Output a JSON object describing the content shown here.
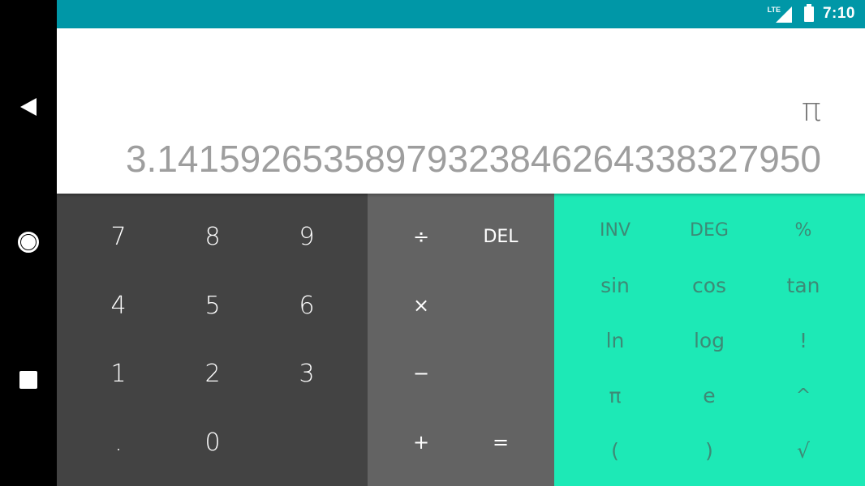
{
  "status_bar": {
    "network": "LTE",
    "time": "7:10"
  },
  "display": {
    "formula": "π",
    "result": "3.14159265358979323846264338327950"
  },
  "numeric_pad": [
    {
      "key": "7"
    },
    {
      "key": "8"
    },
    {
      "key": "9"
    },
    {
      "key": "4"
    },
    {
      "key": "5"
    },
    {
      "key": "6"
    },
    {
      "key": "1"
    },
    {
      "key": "2"
    },
    {
      "key": "3"
    },
    {
      "key": "."
    },
    {
      "key": "0"
    }
  ],
  "operator_pad": {
    "divide": "÷",
    "delete": "DEL",
    "multiply": "×",
    "minus": "−",
    "plus": "+",
    "equals": "="
  },
  "advanced_pad": [
    {
      "key": "INV"
    },
    {
      "key": "DEG"
    },
    {
      "key": "%"
    },
    {
      "key": "sin"
    },
    {
      "key": "cos"
    },
    {
      "key": "tan"
    },
    {
      "key": "ln"
    },
    {
      "key": "log"
    },
    {
      "key": "!"
    },
    {
      "key": "π"
    },
    {
      "key": "e"
    },
    {
      "key": "^"
    },
    {
      "key": "("
    },
    {
      "key": ")"
    },
    {
      "key": "√"
    }
  ],
  "colors": {
    "status_bar": "#0097a7",
    "numeric_pad": "#434343",
    "operator_pad": "#636363",
    "advanced_pad": "#1de9b6"
  },
  "icons": {
    "back": "back-triangle-icon",
    "home": "home-circle-icon",
    "recents": "recents-square-icon"
  }
}
